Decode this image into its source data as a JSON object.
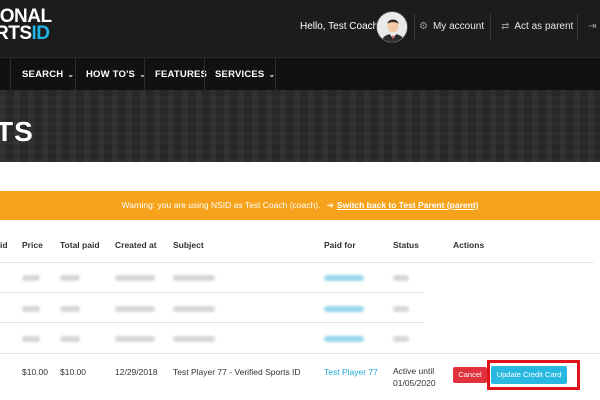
{
  "header": {
    "logo_line1": "IONAL",
    "logo_line2": "RTS",
    "logo_id": "ID",
    "greeting": "Hello, Test Coach",
    "my_account": "My account",
    "act_as_parent": "Act as parent"
  },
  "nav": {
    "items": [
      {
        "label": "SEARCH",
        "dropdown": true
      },
      {
        "label": "HOW TO'S",
        "dropdown": true
      },
      {
        "label": "FEATURES",
        "dropdown": false
      },
      {
        "label": "SERVICES",
        "dropdown": true
      }
    ]
  },
  "hero": {
    "title": "TS"
  },
  "warning": {
    "text": "Warning: you are using NSID as Test Coach (coach).",
    "link": "Switch back to Test Parent (parent)"
  },
  "table": {
    "headers": [
      "id",
      "Price",
      "Total paid",
      "Created at",
      "Subject",
      "Paid for",
      "Status",
      "Actions"
    ],
    "last_row": {
      "price": "$10.00",
      "total_paid": "$10.00",
      "created_at": "12/29/2018",
      "subject": "Test Player 77 - Verified Sports ID",
      "paid_for": "Test Player 77",
      "status_line1": "Active until",
      "status_line2": "01/05/2020"
    },
    "actions": {
      "cancel": "Cancel",
      "update": "Update Credit Card"
    }
  },
  "colors": {
    "header_bg": "#1c1c1c",
    "accent_blue": "#1fb6e6",
    "warning_orange": "#f6a21a",
    "cancel_red": "#e0323c",
    "highlight_red": "#e0121c"
  }
}
